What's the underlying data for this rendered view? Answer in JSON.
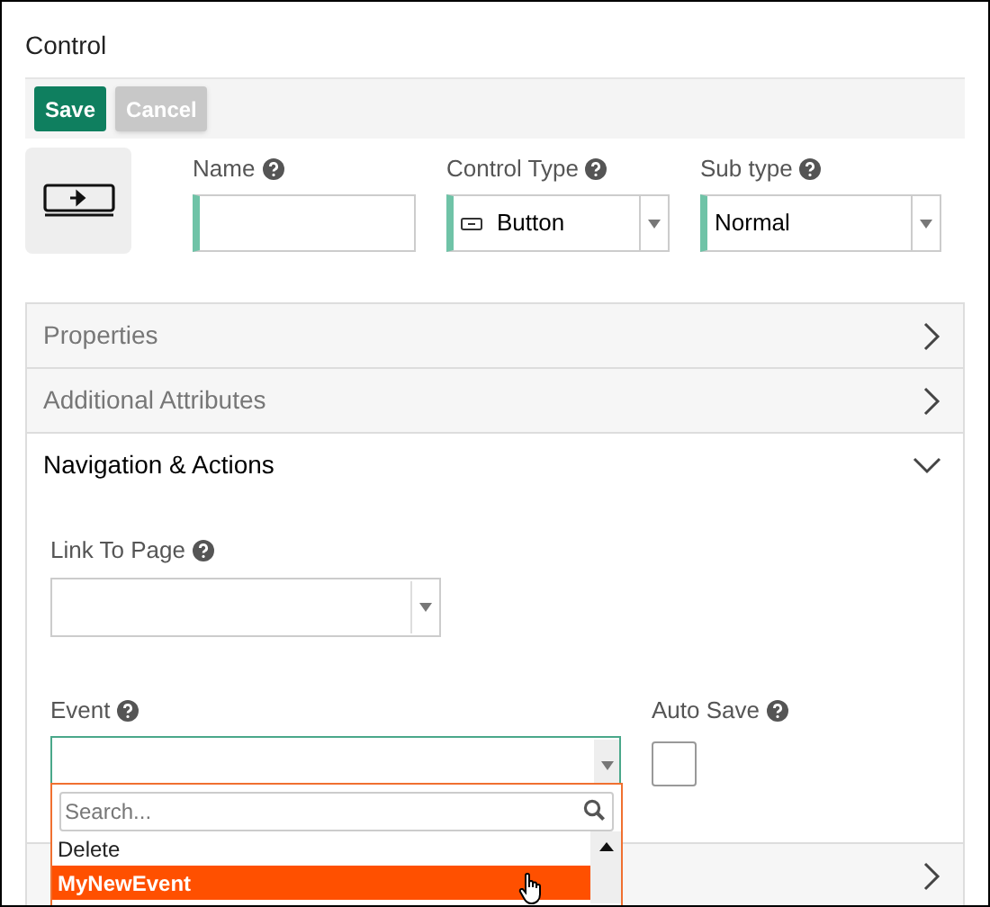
{
  "title": "Control",
  "toolbar": {
    "buttons": [
      {
        "label": "Save",
        "disabled": false
      },
      {
        "label": "Cancel",
        "disabled": true
      }
    ]
  },
  "fields": [
    {
      "label": "Name",
      "kind": "text"
    },
    {
      "label": "Control Type",
      "kind": "select",
      "value": "Button",
      "icon": true
    },
    {
      "label": "Sub type",
      "kind": "select",
      "value": "Normal",
      "icon": false
    }
  ],
  "sections": [
    {
      "title": "Properties",
      "expanded": false
    },
    {
      "title": "Additional Attributes",
      "expanded": false
    },
    {
      "title": "Navigation & Actions",
      "expanded": true,
      "link_to_page": {
        "label": "Link To Page"
      },
      "event": {
        "label": "Event",
        "open": true
      },
      "auto_save": {
        "label": "Auto Save",
        "checked": false
      }
    },
    {
      "expanded": false
    }
  ],
  "dropdown": {
    "search": {
      "placeholder": "Search..."
    },
    "options": [
      {
        "label": "Delete",
        "selected": false
      },
      {
        "label": "MyNewEvent",
        "selected": true
      }
    ]
  }
}
